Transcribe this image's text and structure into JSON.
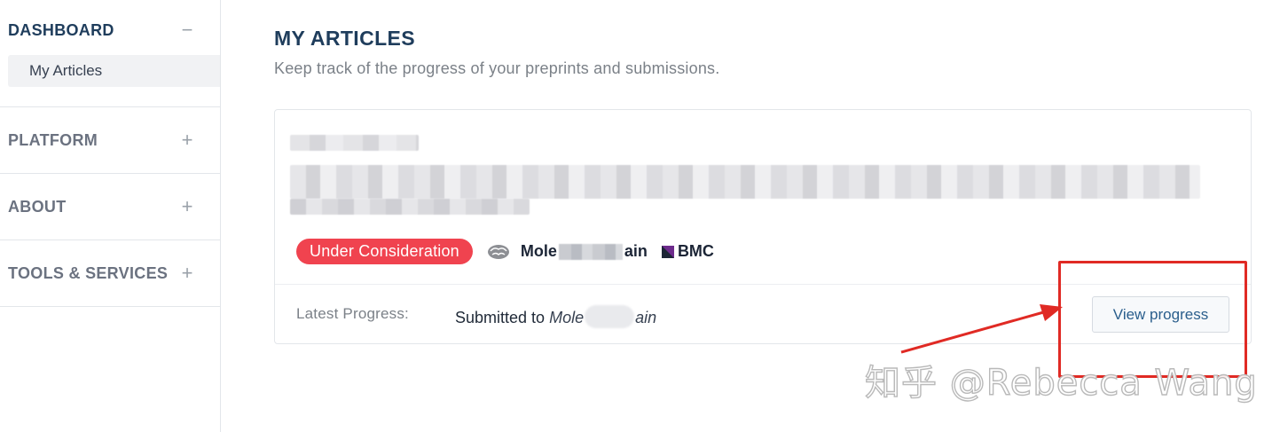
{
  "sidebar": {
    "sections": [
      {
        "label": "DASHBOARD",
        "toggle": "−",
        "items": [
          {
            "label": "My Articles"
          }
        ]
      },
      {
        "label": "PLATFORM",
        "toggle": "+"
      },
      {
        "label": "ABOUT",
        "toggle": "+"
      },
      {
        "label": "TOOLS & SERVICES",
        "toggle": "+"
      }
    ]
  },
  "main": {
    "title": "MY ARTICLES",
    "subtitle": "Keep track of the progress of your preprints and submissions.",
    "article": {
      "status": "Under Consideration",
      "journal_prefix": "Mole",
      "journal_suffix": "ain",
      "publisher": "BMC",
      "latest_progress_label": "Latest Progress:",
      "latest_progress_text": "Submitted to",
      "latest_progress_journal_prefix": "Mole",
      "latest_progress_journal_suffix": "ain",
      "view_button": "View progress"
    }
  },
  "colors": {
    "accent": "#1f3d5c",
    "status_badge": "#f0434f",
    "annotation": "#e02a24",
    "button_text": "#2a5e8c"
  },
  "watermark": "知乎 @Rebecca Wang"
}
